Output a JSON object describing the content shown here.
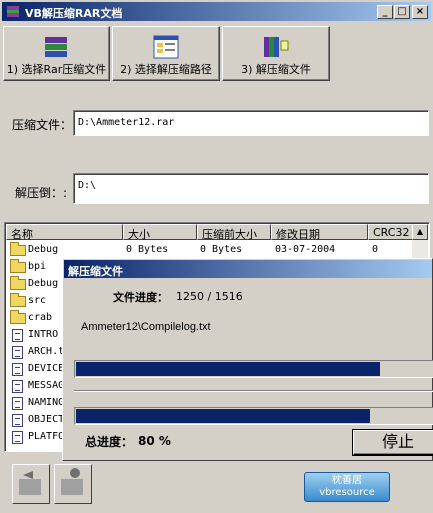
{
  "window": {
    "title": "VB解压缩RAR文档"
  },
  "toolbar": {
    "step1": "1) 选择Rar压缩文件",
    "step2": "2) 选择解压缩路径",
    "step3": "3) 解压缩文件"
  },
  "form": {
    "archive_label": "压缩文件：",
    "archive_value": "D:\\Ammeter12.rar",
    "dest_label": "解压倒：:",
    "dest_value": "D:\\"
  },
  "list": {
    "columns": [
      "名称",
      "大小",
      "压缩前大小",
      "修改日期",
      "CRC32"
    ],
    "rows": [
      {
        "name": "Debug",
        "size": "0 Bytes",
        "orig": "0 Bytes",
        "date": "03-07-2004",
        "crc": "0",
        "type": "folder"
      },
      {
        "name": "bpi",
        "type": "folder"
      },
      {
        "name": "Debug",
        "type": "folder"
      },
      {
        "name": "src",
        "type": "folder"
      },
      {
        "name": "crab",
        "type": "folder"
      },
      {
        "name": "INTRO",
        "type": "file"
      },
      {
        "name": "ARCH.t",
        "type": "file"
      },
      {
        "name": "DEVICE",
        "type": "file"
      },
      {
        "name": "MESSAG",
        "type": "file"
      },
      {
        "name": "NAMING",
        "type": "file"
      },
      {
        "name": "OBJECT",
        "type": "file"
      },
      {
        "name": "PLATFO",
        "type": "file"
      }
    ]
  },
  "dialog": {
    "title": "解压缩文件",
    "file_progress_label": "文件进度：",
    "file_progress_value": "1250 / 1516",
    "current_file": "Ammeter12\\Compilelog.txt",
    "file_progress": 0.825,
    "total_progress": 0.8,
    "total_label": "总进度：",
    "total_value": "80 %",
    "stop_label": "停止"
  },
  "footer": {
    "logo_line1": "枕善居",
    "logo_line2": "vbresource"
  },
  "colors": {
    "title_start": "#0a246a",
    "title_end": "#a6caf0",
    "progress": "#0a246a",
    "face": "#d4d0c8"
  }
}
